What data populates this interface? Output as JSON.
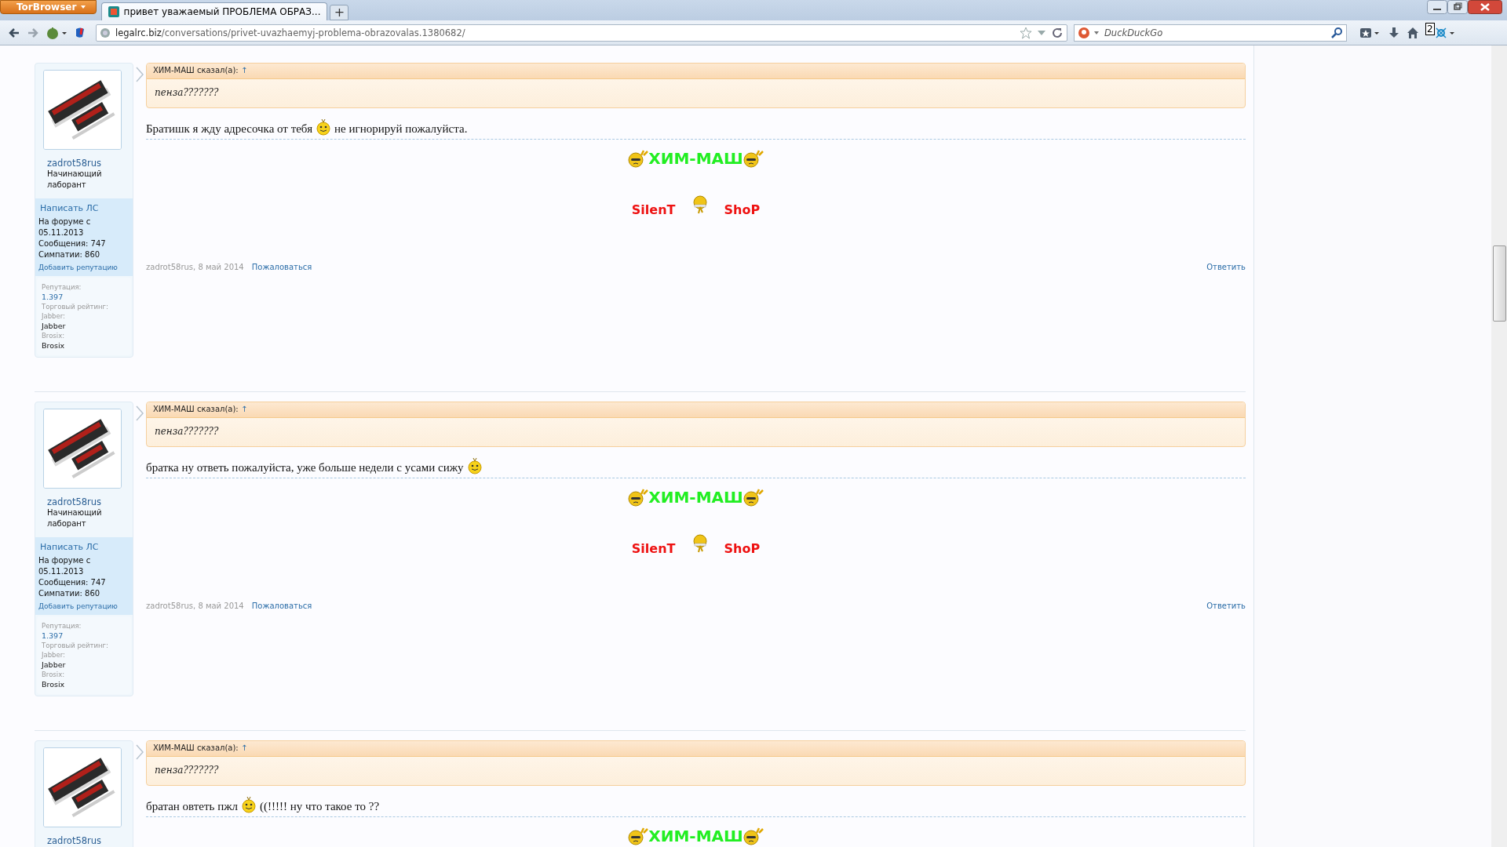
{
  "browser": {
    "menu_button": "TorBrowser",
    "tabs": [
      {
        "title": "привет уважаемый ПРОБЛЕМА ОБРАЗ...",
        "selected": true
      }
    ],
    "new_tab": "+",
    "url_domain": "legalrc.biz",
    "url_path": "/conversations/privet-uvazhaemyj-problema-obrazovalas.1380682/",
    "search_placeholder": "DuckDuckGo",
    "badge": "2"
  },
  "posts": [
    {
      "author": "zadrot58rus",
      "rank": "Начинающий лаборант",
      "pm": "Написать ЛС",
      "joined_label": "На форуме с",
      "joined": "05.11.2013",
      "messages": "Сообщения: 747",
      "likes": "Симпатии: 860",
      "add_rep": "Добавить репутацию",
      "fields": [
        {
          "label": "Репутация:",
          "value": "1.397",
          "kind": "link"
        },
        {
          "label": "Торговый рейтинг:"
        },
        {
          "label": "Jabber:",
          "value": "Jabber",
          "kind": "text"
        },
        {
          "label": "Brosix:",
          "value": "Brosix",
          "kind": "text"
        }
      ],
      "quote": {
        "header": "ХИМ-МАШ сказал(а):",
        "arrow": "↑",
        "text": "пенза???????"
      },
      "message": [
        {
          "kind": "text",
          "text": "Братишк я жду адресочка от тебя"
        },
        {
          "kind": "smiley"
        },
        {
          "kind": "text",
          "text": "не игнорируй пожалуйста."
        }
      ],
      "signature": {
        "title": "ХИМ-МАШ",
        "left": "SilenT",
        "right": "ShoP"
      },
      "footer": {
        "meta": "zadrot58rus, 8 май 2014",
        "report": "Пожаловаться",
        "reply": "Ответить"
      }
    },
    {
      "author": "zadrot58rus",
      "rank": "Начинающий лаборант",
      "pm": "Написать ЛС",
      "joined_label": "На форуме с",
      "joined": "05.11.2013",
      "messages": "Сообщения: 747",
      "likes": "Симпатии: 860",
      "add_rep": "Добавить репутацию",
      "fields": [
        {
          "label": "Репутация:",
          "value": "1.397",
          "kind": "link"
        },
        {
          "label": "Торговый рейтинг:"
        },
        {
          "label": "Jabber:",
          "value": "Jabber",
          "kind": "text"
        },
        {
          "label": "Brosix:",
          "value": "Brosix",
          "kind": "text"
        }
      ],
      "quote": {
        "header": "ХИМ-МАШ сказал(а):",
        "arrow": "↑",
        "text": "пенза???????"
      },
      "message": [
        {
          "kind": "text",
          "text": "братка ну ответь пожалуйста, уже больше недели с усами сижу"
        },
        {
          "kind": "smiley"
        }
      ],
      "signature": {
        "title": "ХИМ-МАШ",
        "left": "SilenT",
        "right": "ShoP"
      },
      "footer": {
        "meta": "zadrot58rus, 8 май 2014",
        "report": "Пожаловаться",
        "reply": "Ответить"
      }
    },
    {
      "author": "zadrot58rus",
      "quote": {
        "header": "ХИМ-МАШ сказал(а):",
        "arrow": "↑",
        "text": "пенза???????"
      },
      "message": [
        {
          "kind": "text",
          "text": "братан овтеть пжл"
        },
        {
          "kind": "smiley"
        },
        {
          "kind": "text",
          "text": "((!!!!! ну что такое то ??"
        }
      ],
      "signature": {
        "title": "ХИМ-МАШ"
      }
    }
  ]
}
